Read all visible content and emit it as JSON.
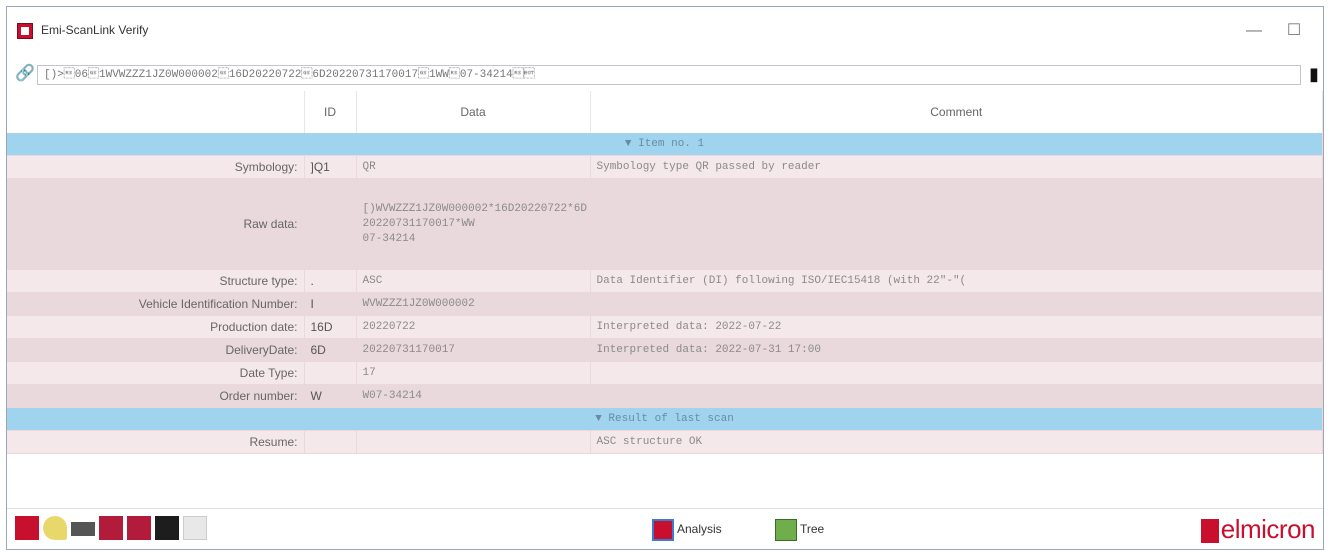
{
  "window": {
    "title": "Emi-ScanLink Verify",
    "minimize": "—",
    "maximize": "☐"
  },
  "toolbar": {
    "raw_value": "[)>\u001e06\u001d1WVWZZZ1JZ0W000002\u001d16D20220722\u001d6D20220731170017\u001d1WW\u001e07-34214\u001e\u0004"
  },
  "table": {
    "headers": [
      "",
      "ID",
      "Data",
      "Comment"
    ],
    "section1": "▼ Item no. 1",
    "rows": [
      {
        "label": "Symbology:",
        "id": "]Q1",
        "data": "QR",
        "comment": "Symbology type QR passed by reader"
      },
      {
        "label": "Raw data:",
        "id": "",
        "data": "[)WVWZZZ1JZ0W000002*16D20220722*6D\n20220731170017*WW\n07-34214",
        "comment": ""
      },
      {
        "label": "Structure type:",
        "id": ".",
        "data": "ASC",
        "comment": "Data Identifier (DI) following ISO/IEC15418 (with 22\"-\"("
      },
      {
        "label": "Vehicle Identification Number:",
        "id": "I",
        "data": "WVWZZZ1JZ0W000002",
        "comment": ""
      },
      {
        "label": "Production date:",
        "id": "16D",
        "data": "20220722",
        "comment": "Interpreted data: 2022-07-22"
      },
      {
        "label": "DeliveryDate:",
        "id": "6D",
        "data": "20220731170017",
        "comment": "Interpreted data: 2022-07-31 17:00"
      },
      {
        "label": "Date Type:",
        "id": "",
        "data": "17",
        "comment": ""
      },
      {
        "label": "Order number:",
        "id": "W",
        "data": "W07-34214",
        "comment": ""
      }
    ],
    "section2": "▼ Result of last scan",
    "result_row": {
      "label": "Resume:",
      "id": "",
      "data": "",
      "comment": "ASC structure OK"
    }
  },
  "statusbar": {
    "analysis_label": "Analysis",
    "tree_label": "Tree",
    "logo_text": "elmicron"
  },
  "colors": {
    "brand": "#c8102e",
    "section": "#9fd3ee",
    "row": "#f5e8ea",
    "row_alt": "#ead9dc"
  }
}
